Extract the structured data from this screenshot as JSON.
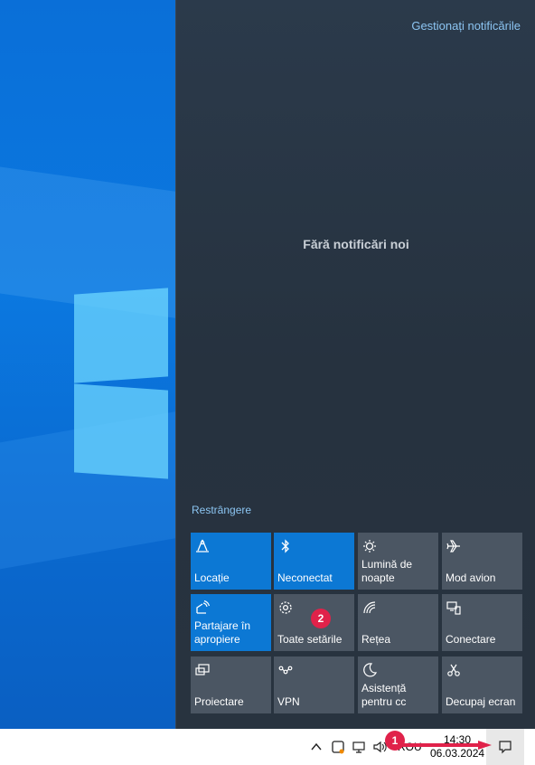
{
  "action_center": {
    "manage_link": "Gestionați notificările",
    "empty_message": "Fără notificări noi",
    "collapse_link": "Restrângere",
    "tiles": [
      {
        "label": "Locație",
        "icon": "location-icon",
        "state": "on"
      },
      {
        "label": "Neconectat",
        "icon": "bluetooth-icon",
        "state": "on"
      },
      {
        "label": "Lumină de noapte",
        "icon": "night-light-icon",
        "state": "off"
      },
      {
        "label": "Mod avion",
        "icon": "airplane-icon",
        "state": "off"
      },
      {
        "label": "Partajare în apropiere",
        "icon": "nearby-sharing-icon",
        "state": "on"
      },
      {
        "label": "Toate setările",
        "icon": "settings-gear-icon",
        "state": "off"
      },
      {
        "label": "Rețea",
        "icon": "network-icon",
        "state": "off"
      },
      {
        "label": "Conectare",
        "icon": "connect-icon",
        "state": "off"
      },
      {
        "label": "Proiectare",
        "icon": "project-icon",
        "state": "off"
      },
      {
        "label": "VPN",
        "icon": "vpn-icon",
        "state": "off"
      },
      {
        "label": "Asistență pentru cc",
        "icon": "focus-assist-icon",
        "state": "off"
      },
      {
        "label": "Decupaj ecran",
        "icon": "screen-snip-icon",
        "state": "off"
      }
    ]
  },
  "taskbar": {
    "time": "14:30",
    "date": "06.03.2024",
    "language": "ROU",
    "icons": [
      "chevron-up-icon",
      "app-tray-icon",
      "network-monitor-icon",
      "volume-icon"
    ]
  },
  "annotations": {
    "marker_1": "1",
    "marker_2": "2"
  },
  "colors": {
    "accent_tile": "#0c78d4",
    "inactive_tile": "#4b5663",
    "marker": "#e0224a",
    "link": "#8cc5f2"
  }
}
